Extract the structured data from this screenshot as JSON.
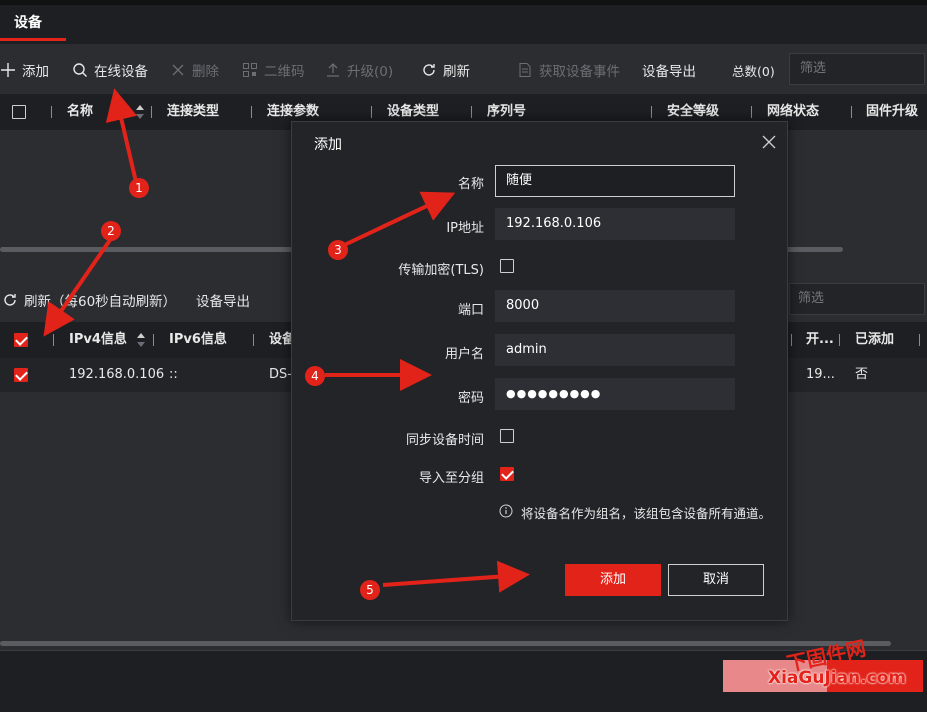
{
  "header": {
    "tab_label": "设备"
  },
  "toolbar": {
    "add": "添加",
    "online_devices": "在线设备",
    "delete": "删除",
    "qrcode": "二维码",
    "upgrade": "升级(0)",
    "refresh": "刷新",
    "get_events": "获取设备事件",
    "export": "设备导出",
    "total": "总数(0)",
    "filter_placeholder": "筛选"
  },
  "table1": {
    "columns": [
      "名称",
      "连接类型",
      "连接参数",
      "设备类型",
      "序列号",
      "安全等级",
      "网络状态",
      "固件升级"
    ]
  },
  "section2": {
    "refresh": "刷新（每60秒自动刷新）",
    "export": "设备导出",
    "filter_placeholder": "筛选",
    "columns": [
      "IPv4信息",
      "IPv6信息",
      "设备",
      "开...",
      "已添加"
    ],
    "row": {
      "ipv4": "192.168.0.106",
      "ipv6": "::",
      "device": "DS-",
      "port": "19...",
      "added": "否"
    }
  },
  "modal": {
    "title": "添加",
    "name_label": "名称",
    "name_value": "随便",
    "ip_label": "IP地址",
    "ip_value": "192.168.0.106",
    "tls_label": "传输加密(TLS)",
    "port_label": "端口",
    "port_value": "8000",
    "user_label": "用户名",
    "user_value": "admin",
    "password_label": "密码",
    "password_value": "●●●●●●●●●",
    "sync_label": "同步设备时间",
    "import_label": "导入至分组",
    "info_text": "将设备名作为组名，该组包含设备所有通道。",
    "ok_button": "添加",
    "cancel_button": "取消"
  },
  "annotations": [
    "1",
    "2",
    "3",
    "4",
    "5"
  ],
  "watermark": {
    "line1": "下固件网",
    "line2": "XiaGuJian.com"
  },
  "colors": {
    "accent": "#e2231a",
    "background": "#2b2d31",
    "panel": "#232428",
    "header": "#1e1f22"
  }
}
